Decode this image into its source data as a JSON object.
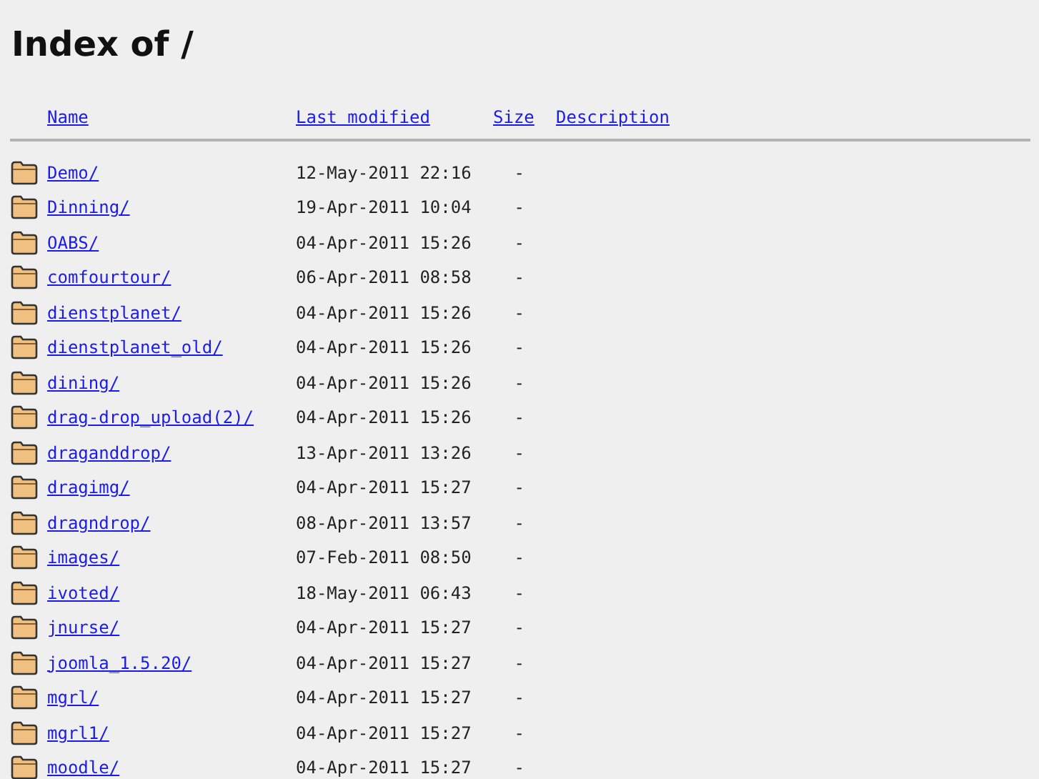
{
  "title": "Index of /",
  "columns": [
    "Name",
    "Last modified",
    "Size",
    "Description"
  ],
  "rows": [
    {
      "name": "Demo/",
      "modified": "12-May-2011 22:16",
      "size": "-"
    },
    {
      "name": "Dinning/",
      "modified": "19-Apr-2011 10:04",
      "size": "-"
    },
    {
      "name": "OABS/",
      "modified": "04-Apr-2011 15:26",
      "size": "-"
    },
    {
      "name": "comfourtour/",
      "modified": "06-Apr-2011 08:58",
      "size": "-"
    },
    {
      "name": "dienstplanet/",
      "modified": "04-Apr-2011 15:26",
      "size": "-"
    },
    {
      "name": "dienstplanet_old/",
      "modified": "04-Apr-2011 15:26",
      "size": "-"
    },
    {
      "name": "dining/",
      "modified": "04-Apr-2011 15:26",
      "size": "-"
    },
    {
      "name": "drag-drop_upload(2)/",
      "modified": "04-Apr-2011 15:26",
      "size": "-"
    },
    {
      "name": "draganddrop/",
      "modified": "13-Apr-2011 13:26",
      "size": "-"
    },
    {
      "name": "dragimg/",
      "modified": "04-Apr-2011 15:27",
      "size": "-"
    },
    {
      "name": "dragndrop/",
      "modified": "08-Apr-2011 13:57",
      "size": "-"
    },
    {
      "name": "images/",
      "modified": "07-Feb-2011 08:50",
      "size": "-"
    },
    {
      "name": "ivoted/",
      "modified": "18-May-2011 06:43",
      "size": "-"
    },
    {
      "name": "jnurse/",
      "modified": "04-Apr-2011 15:27",
      "size": "-"
    },
    {
      "name": "joomla_1.5.20/",
      "modified": "04-Apr-2011 15:27",
      "size": "-"
    },
    {
      "name": "mgrl/",
      "modified": "04-Apr-2011 15:27",
      "size": "-"
    },
    {
      "name": "mgrl1/",
      "modified": "04-Apr-2011 15:27",
      "size": "-"
    },
    {
      "name": "moodle/",
      "modified": "04-Apr-2011 15:27",
      "size": "-"
    }
  ]
}
